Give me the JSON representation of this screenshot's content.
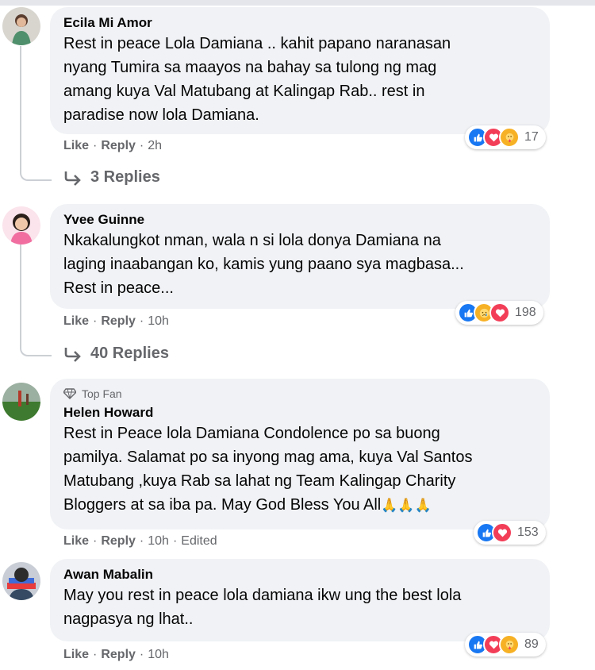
{
  "actions": {
    "like": "Like",
    "reply": "Reply",
    "sep": "·"
  },
  "comments": [
    {
      "author": "Ecila Mi Amor",
      "text": "Rest in peace Lola Damiana .. kahit papano naranasan\nnyang Tumira sa maayos na bahay sa tulong ng mag\namang kuya Val Matubang at Kalingap Rab.. rest in\nparadise now lola Damiana.",
      "time": "2h",
      "reactions": [
        "like",
        "love",
        "care"
      ],
      "reaction_count": "17",
      "replies": "3 Replies"
    },
    {
      "author": "Yvee Guinne",
      "text": "Nkakalungkot nman, wala n si lola donya Damiana na\nlaging inaabangan ko, kamis yung paano sya magbasa...\nRest in peace...",
      "time": "10h",
      "reactions": [
        "like",
        "sad",
        "love"
      ],
      "reaction_count": "198",
      "replies": "40 Replies"
    },
    {
      "badge": "Top Fan",
      "author": "Helen Howard",
      "text": "Rest in Peace lola Damiana Condolence po sa buong\npamilya. Salamat po sa inyong mag ama, kuya Val Santos\nMatubang ,kuya Rab sa lahat ng Team Kalingap Charity\nBloggers at sa iba pa. May God Bless You All",
      "emoji": "🙏🙏🙏",
      "time": "10h",
      "edited": "Edited",
      "reactions": [
        "like",
        "love"
      ],
      "reaction_count": "153"
    },
    {
      "author": "Awan Mabalin",
      "text": "May you rest in peace lola damiana ikw ung the best lola\nnagpasya ng lhat..",
      "time": "10h",
      "reactions": [
        "like",
        "love",
        "care"
      ],
      "reaction_count": "89"
    }
  ]
}
